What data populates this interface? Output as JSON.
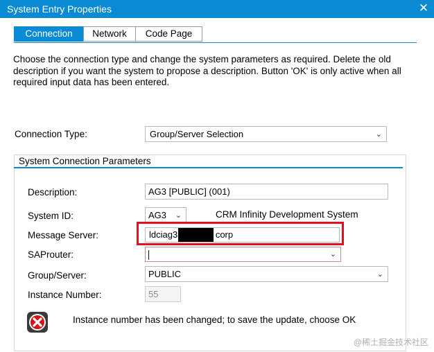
{
  "window": {
    "title": "System Entry Properties",
    "close_glyph": "✕"
  },
  "tabs": [
    {
      "label": "Connection",
      "active": true
    },
    {
      "label": "Network",
      "active": false
    },
    {
      "label": "Code Page",
      "active": false
    }
  ],
  "description": "Choose the connection type and change the system parameters as required. Delete the old description if you want the system to propose a description. Button 'OK' is only active when all required input data has been entered.",
  "connection_type": {
    "label": "Connection Type:",
    "value": "Group/Server Selection"
  },
  "group": {
    "title": "System Connection Parameters",
    "description": {
      "label": "Description:",
      "value": "AG3 [PUBLIC] (001)"
    },
    "system_id": {
      "label": "System ID:",
      "value": "AG3",
      "system_name": "CRM Infinity Development System"
    },
    "message_server": {
      "label": "Message Server:",
      "value_prefix": "ldciag3.",
      "value_suffix": "corp"
    },
    "saprouter": {
      "label": "SAProuter:",
      "value": ""
    },
    "group_server": {
      "label": "Group/Server:",
      "value": "PUBLIC"
    },
    "instance_number": {
      "label": "Instance Number:",
      "value": "55"
    }
  },
  "message": {
    "icon": "error-x-icon",
    "text": "Instance number has been changed; to save the update, choose OK"
  },
  "watermark": "@稀土掘金技术社区",
  "colors": {
    "accent": "#0a8ad2",
    "highlight": "#e0101c"
  }
}
